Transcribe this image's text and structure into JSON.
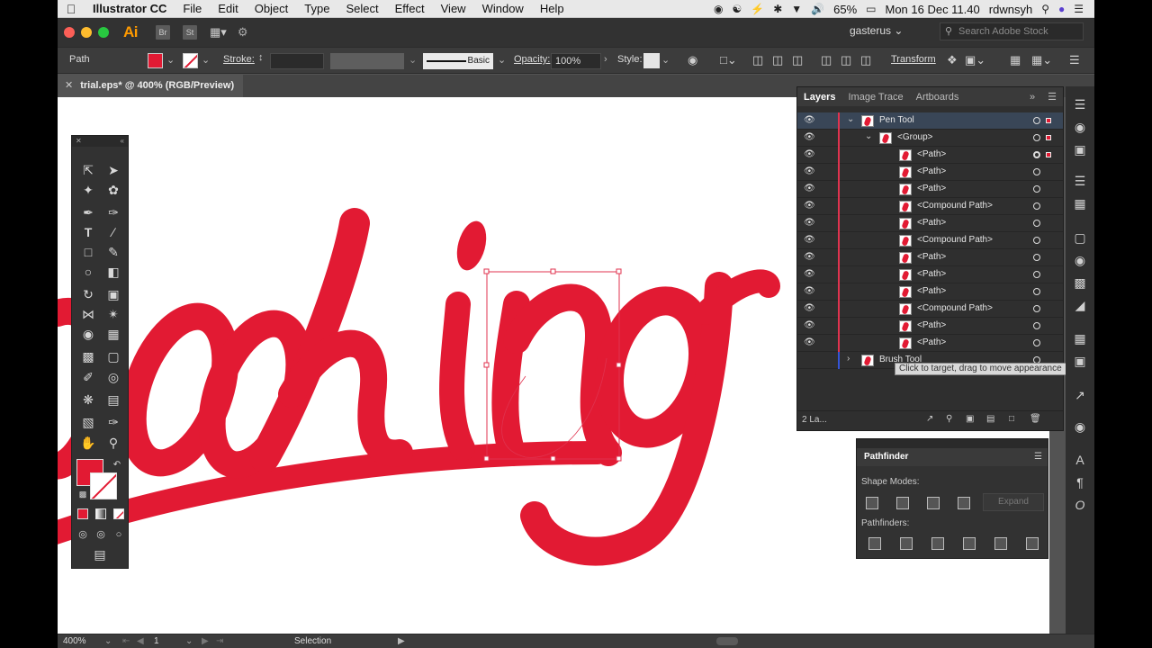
{
  "menubar": {
    "app_name": "Illustrator CC",
    "menus": [
      "File",
      "Edit",
      "Object",
      "Type",
      "Select",
      "Effect",
      "View",
      "Window",
      "Help"
    ],
    "battery": "65%",
    "datetime": "Mon 16 Dec  11.40",
    "user": "rdwnsyh"
  },
  "appbar": {
    "logo": "Ai",
    "bridge": "Br",
    "stock": "St",
    "workspace": "gasterus",
    "search_placeholder": "Search Adobe Stock"
  },
  "control": {
    "selection_type": "Path",
    "stroke_label": "Stroke:",
    "brush_label": "Basic",
    "opacity_label": "Opacity:",
    "opacity_value": "100%",
    "style_label": "Style:",
    "transform_label": "Transform"
  },
  "document": {
    "tab_title": "trial.eps* @ 400% (RGB/Preview)"
  },
  "artwork": {
    "text": "oothing",
    "color": "#e21a33"
  },
  "layers": {
    "tabs": [
      "Layers",
      "Image Trace",
      "Artboards"
    ],
    "rows": [
      {
        "name": "Pen Tool"
      },
      {
        "name": "<Group>"
      },
      {
        "name": "<Path>"
      },
      {
        "name": "<Path>"
      },
      {
        "name": "<Path>"
      },
      {
        "name": "<Compound Path>"
      },
      {
        "name": "<Path>"
      },
      {
        "name": "<Compound Path>"
      },
      {
        "name": "<Path>"
      },
      {
        "name": "<Path>"
      },
      {
        "name": "<Path>"
      },
      {
        "name": "<Compound Path>"
      },
      {
        "name": "<Path>"
      },
      {
        "name": "<Path>"
      },
      {
        "name": "Brush Tool"
      }
    ],
    "tooltip": "Click to target, drag to move appearance",
    "footer_count": "2 La..."
  },
  "pathfinder": {
    "title": "Pathfinder",
    "shape_modes": "Shape Modes:",
    "expand": "Expand",
    "pathfinders": "Pathfinders:"
  },
  "status": {
    "zoom": "400%",
    "artboard": "1",
    "tool": "Selection"
  },
  "colors": {
    "accent": "#e21a33",
    "panel": "#2f2f2f",
    "selected_row": "#394657"
  }
}
